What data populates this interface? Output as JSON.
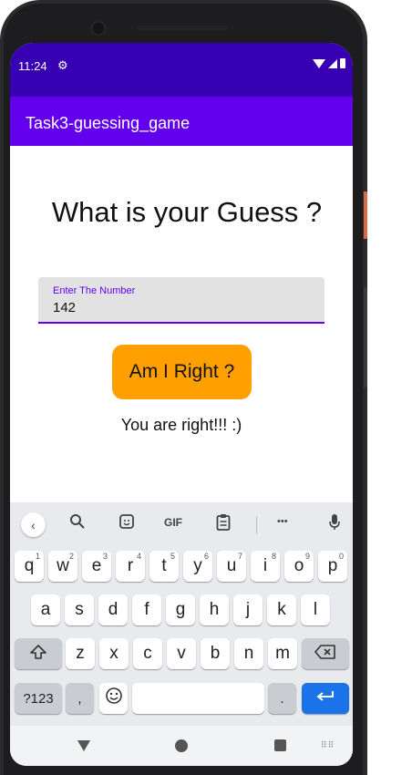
{
  "status_bar": {
    "time": "11:24",
    "settings_icon": "gear-icon",
    "wifi_icon": "wifi-icon",
    "signal_icon": "signal-icon",
    "battery_icon": "battery-icon"
  },
  "app_bar": {
    "title": "Task3-guessing_game"
  },
  "main": {
    "question": "What is your Guess ?",
    "input_label": "Enter The Number",
    "input_value": "142",
    "button_label": "Am I Right ?",
    "result_text": "You are right!!! :)"
  },
  "keyboard": {
    "toolbar": {
      "gif_label": "GIF",
      "more_label": "•••"
    },
    "row1": [
      {
        "l": "q",
        "n": "1"
      },
      {
        "l": "w",
        "n": "2"
      },
      {
        "l": "e",
        "n": "3"
      },
      {
        "l": "r",
        "n": "4"
      },
      {
        "l": "t",
        "n": "5"
      },
      {
        "l": "y",
        "n": "6"
      },
      {
        "l": "u",
        "n": "7"
      },
      {
        "l": "i",
        "n": "8"
      },
      {
        "l": "o",
        "n": "9"
      },
      {
        "l": "p",
        "n": "0"
      }
    ],
    "row2": [
      "a",
      "s",
      "d",
      "f",
      "g",
      "h",
      "j",
      "k",
      "l"
    ],
    "row3": [
      "z",
      "x",
      "c",
      "v",
      "b",
      "n",
      "m"
    ],
    "symbols_label": "?123",
    "comma_label": ",",
    "period_label": ".",
    "space_label": ""
  },
  "colors": {
    "status_bar": "#3700b3",
    "app_bar": "#6200ee",
    "button": "#ffa000",
    "enter_key": "#1a73e8"
  }
}
